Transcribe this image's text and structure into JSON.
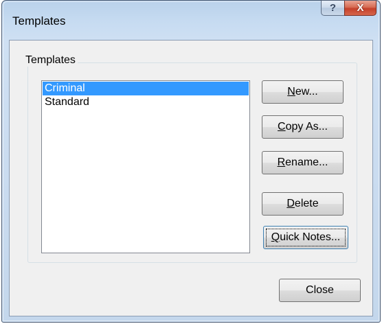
{
  "window": {
    "title": "Templates",
    "help_glyph": "?",
    "close_glyph": "X"
  },
  "group": {
    "label": "Templates"
  },
  "templates": [
    {
      "name": "Criminal",
      "selected": true
    },
    {
      "name": "Standard",
      "selected": false
    }
  ],
  "buttons": {
    "new": {
      "accel": "N",
      "rest": "ew..."
    },
    "copy_as": {
      "accel": "C",
      "rest": "opy As..."
    },
    "rename": {
      "accel": "R",
      "rest": "ename..."
    },
    "delete": {
      "accel": "D",
      "rest": "elete"
    },
    "quick_notes": {
      "accel": "Q",
      "rest": "uick Notes..."
    },
    "close": {
      "label": "Close"
    }
  },
  "colors": {
    "selection": "#3399ff",
    "close_button": "#c4402a",
    "dialog_background": "#f0f0f0"
  }
}
